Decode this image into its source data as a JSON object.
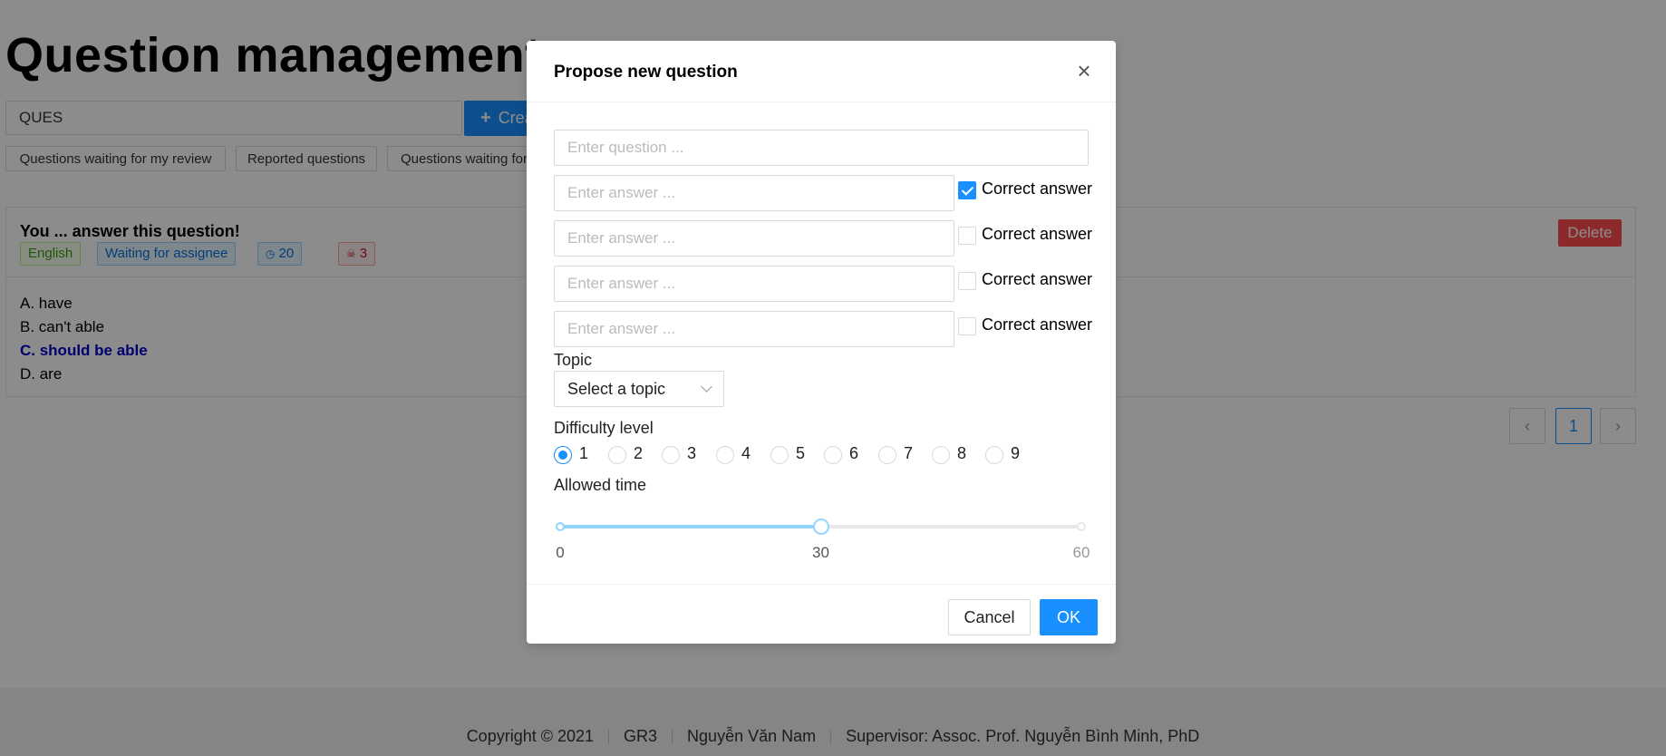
{
  "page": {
    "title": "Question management",
    "search_value": "QUES",
    "create_label": "Create",
    "filters": [
      "Questions waiting for my review",
      "Reported questions",
      "Questions waiting for"
    ],
    "question": {
      "title": "You ... answer this question!",
      "tags": {
        "language": "English",
        "status": "Waiting for assignee",
        "time": "20",
        "reports": "3"
      },
      "answers": {
        "a": "A. have",
        "b": "B. can't able",
        "c": "C. should be able",
        "d": "D. are"
      },
      "delete_label": "Delete"
    },
    "pagination": {
      "prev": "‹",
      "current": "1",
      "next": "›"
    }
  },
  "footer": {
    "copyright": "Copyright © 2021",
    "project": "GR3",
    "author": "Nguyễn Văn Nam",
    "supervisor": "Supervisor: Assoc. Prof. Nguyễn Bình Minh, PhD"
  },
  "modal": {
    "title": "Propose new question",
    "close": "×",
    "question_placeholder": "Enter question ...",
    "answer_placeholder": "Enter answer ...",
    "correct_label": "Correct answer",
    "answers_correct": [
      true,
      false,
      false,
      false
    ],
    "topic_label": "Topic",
    "topic_placeholder": "Select a topic",
    "difficulty_label": "Difficulty level",
    "difficulty_options": [
      "1",
      "2",
      "3",
      "4",
      "5",
      "6",
      "7",
      "8",
      "9"
    ],
    "difficulty_selected": "1",
    "time_label": "Allowed time",
    "time_min": "0",
    "time_value": "30",
    "time_max": "60",
    "cancel_label": "Cancel",
    "ok_label": "OK"
  },
  "colors": {
    "primary": "#1890ff",
    "danger": "#ff4d4f",
    "correct_answer": "#0000cc"
  }
}
